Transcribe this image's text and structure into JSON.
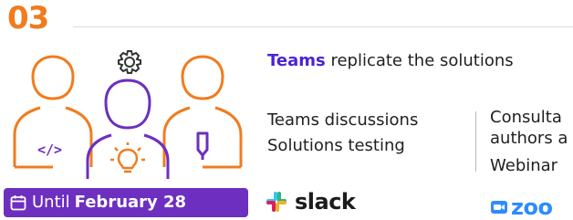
{
  "step": {
    "number": "03"
  },
  "intro": {
    "brand": "Teams",
    "text": " replicate the solutions"
  },
  "teams_column": {
    "items": [
      "Teams discussions",
      "Solutions testing"
    ]
  },
  "consult_column": {
    "line1": "Consulta",
    "line2": "authors a",
    "webinar": "Webinar"
  },
  "deadline": {
    "prefix": "Until",
    "date": "February 28"
  },
  "logos": {
    "slack": "slack",
    "zoom": "zoo"
  },
  "colors": {
    "accent_orange": "#f07c1f",
    "accent_purple": "#6d2fc0",
    "brand_purple": "#4b22d6",
    "zoom_blue": "#2d8cff"
  },
  "icons": [
    "gear-icon",
    "person-orange-code-icon",
    "person-purple-lightbulb-icon",
    "person-orange-pen-icon",
    "calendar-icon",
    "slack-icon",
    "zoom-icon"
  ]
}
